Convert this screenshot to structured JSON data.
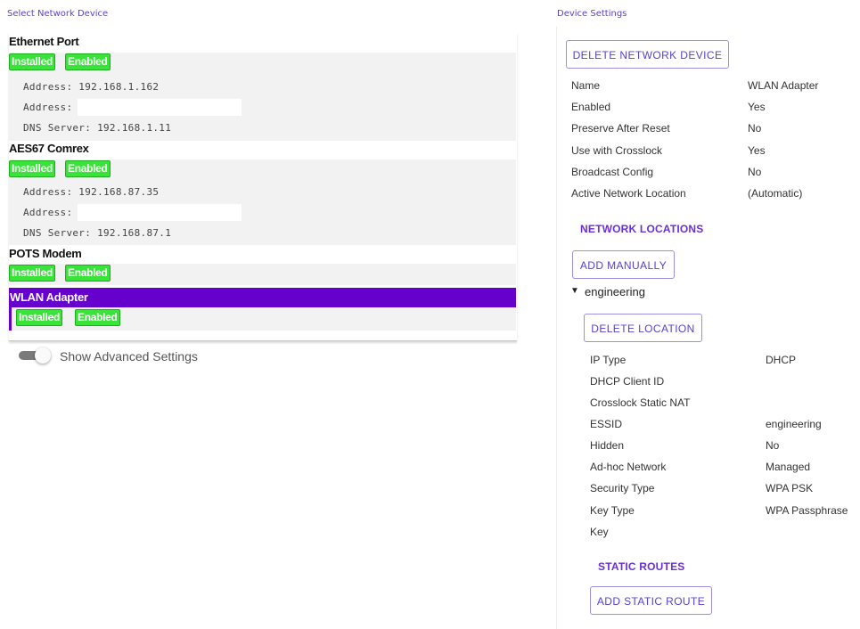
{
  "left": {
    "title": "Select Network Device",
    "devices": [
      {
        "name": "Ethernet Port",
        "installed": "Installed",
        "enabled": "Enabled",
        "address1": "Address: 192.168.1.162",
        "address2": "Address:",
        "dns": "DNS Server: 192.168.1.11"
      },
      {
        "name": "AES67 Comrex",
        "installed": "Installed",
        "enabled": "Enabled",
        "address1": "Address: 192.168.87.35",
        "address2": "Address:",
        "dns": "DNS Server: 192.168.87.1"
      },
      {
        "name": "POTS Modem",
        "installed": "Installed",
        "enabled": "Enabled"
      },
      {
        "name": "WLAN Adapter",
        "installed": "Installed",
        "enabled": "Enabled"
      }
    ],
    "advanced_label": "Show Advanced Settings"
  },
  "right": {
    "title": "Device Settings",
    "delete_device_button": "DELETE NETWORK DEVICE",
    "settings": [
      {
        "key": "Name",
        "value": "WLAN Adapter"
      },
      {
        "key": "Enabled",
        "value": "Yes"
      },
      {
        "key": "Preserve After Reset",
        "value": "No"
      },
      {
        "key": "Use with Crosslock",
        "value": "Yes"
      },
      {
        "key": "Broadcast Config",
        "value": "No"
      },
      {
        "key": "Active Network Location",
        "value": "(Automatic)"
      }
    ],
    "network_locations_heading": "NETWORK LOCATIONS",
    "add_manually_button": "ADD MANUALLY",
    "location_caret": "▼",
    "location_name": "engineering",
    "delete_location_button": "DELETE LOCATION",
    "location_settings": [
      {
        "key": "IP Type",
        "value": "DHCP"
      },
      {
        "key": "DHCP Client ID",
        "value": ""
      },
      {
        "key": "Crosslock Static NAT",
        "value": ""
      },
      {
        "key": "ESSID",
        "value": "engineering"
      },
      {
        "key": "Hidden",
        "value": "No"
      },
      {
        "key": "Ad-hoc Network",
        "value": "Managed"
      },
      {
        "key": "Security Type",
        "value": "WPA PSK"
      },
      {
        "key": "Key Type",
        "value": "WPA Passphrase"
      },
      {
        "key": "Key",
        "value": ""
      }
    ],
    "static_routes_heading": "STATIC ROUTES",
    "add_static_route_button": "ADD STATIC ROUTE"
  },
  "colors": {
    "accent": "#6600cc",
    "badge_green": "#3ae33a",
    "link_purple": "#5a3fd0"
  }
}
